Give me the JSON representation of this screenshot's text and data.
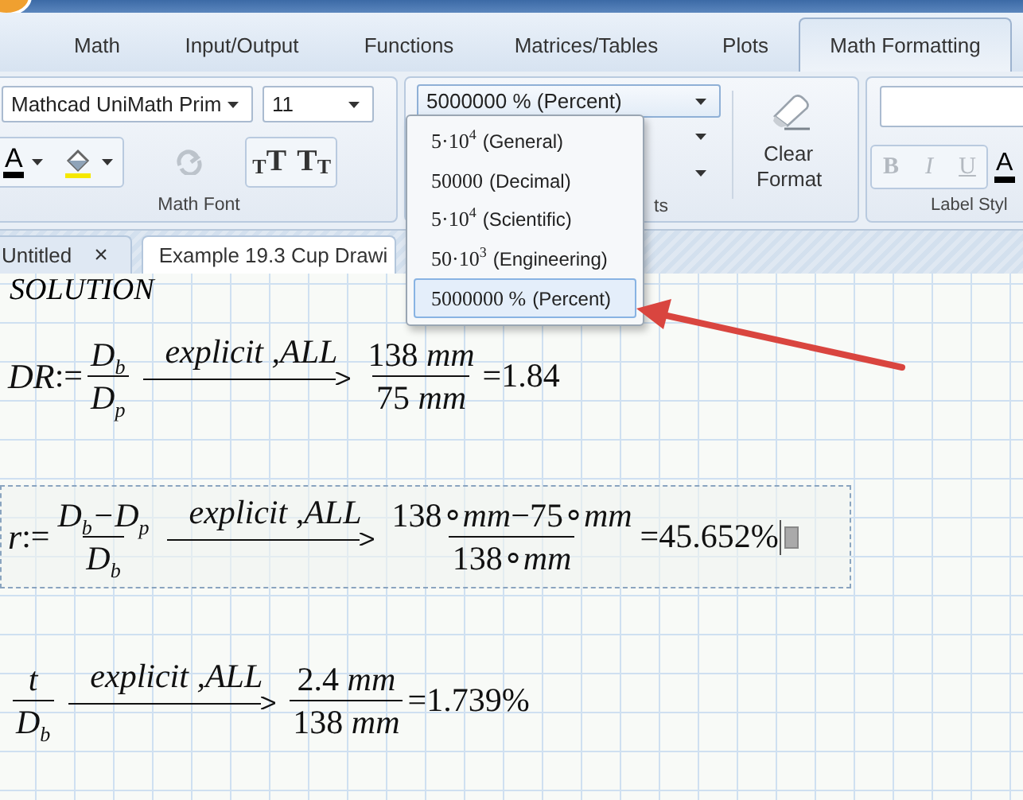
{
  "ribbon_tabs": [
    {
      "label": "Math",
      "selected": false
    },
    {
      "label": "Input/Output",
      "selected": false
    },
    {
      "label": "Functions",
      "selected": false
    },
    {
      "label": "Matrices/Tables",
      "selected": false
    },
    {
      "label": "Plots",
      "selected": false
    },
    {
      "label": "Math Formatting",
      "selected": true
    }
  ],
  "math_font_group": {
    "font": "Mathcad UniMath Prim",
    "size": "11",
    "text_color_letter": "A",
    "increase_font": [
      "T",
      "T"
    ],
    "decrease_font": [
      "T",
      "T"
    ],
    "label": "Math Font"
  },
  "results_group": {
    "format": "5000000 % (Percent)",
    "clear_format": "Clear Format",
    "label": "ts"
  },
  "label_styles_group": {
    "buttons": [
      {
        "label": "B",
        "disabled": true
      },
      {
        "label": "I",
        "disabled": true
      },
      {
        "label": "U",
        "disabled": true
      }
    ],
    "text_color_letter": "A",
    "label": "Label Styl"
  },
  "document_tabs": [
    {
      "label": "Untitled",
      "close": "×",
      "selected": false
    },
    {
      "label": "Example 19.3 Cup Drawi",
      "selected": true
    }
  ],
  "format_menu": [
    {
      "value": "5·10$^{4}$",
      "label": "(General)",
      "selected": false
    },
    {
      "value": "50000",
      "label": "(Decimal)",
      "selected": false
    },
    {
      "value": "5·10$^{4}$",
      "label": "(Scientific)",
      "selected": false
    },
    {
      "value": "50·10$^{3}$",
      "label": "(Engineering)",
      "selected": false
    },
    {
      "value": "5000000 %",
      "label": "(Percent)",
      "selected": true
    }
  ],
  "worksheet": {
    "heading": "SOLUTION",
    "equations": [
      {
        "lhs": "DR",
        "assign": ":=",
        "expr": {
          "num": "D$_{b}$",
          "den": "D$_{p}$"
        },
        "keyword": "explicit ,ALL",
        "result": {
          "num": "138 *mm*",
          "den": "75 *mm*"
        },
        "equals": "=",
        "value": "1.84",
        "selected": false
      },
      {
        "lhs": "r",
        "assign": ":=",
        "expr": {
          "num": "D$_{b}$−D$_{p}$",
          "den": "D$_{b}$"
        },
        "keyword": "explicit ,ALL",
        "result": {
          "num": "138∘*mm*−75∘*mm*",
          "den": "138∘*mm*"
        },
        "equals": "=",
        "value": "45.652%",
        "selected": true
      },
      {
        "expr": {
          "num": "t",
          "den": "D$_{b}$"
        },
        "keyword": "explicit ,ALL",
        "result": {
          "num": "2.4 *mm*",
          "den": "138 *mm*"
        },
        "equals": "=",
        "value": "1.739%",
        "selected": false
      }
    ]
  }
}
